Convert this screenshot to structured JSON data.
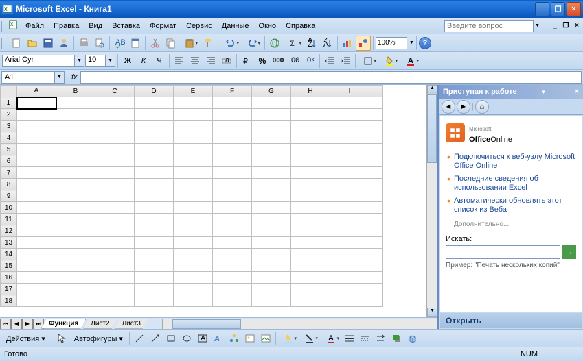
{
  "title": "Microsoft Excel - Книга1",
  "menu": {
    "file": "Файл",
    "edit": "Правка",
    "view": "Вид",
    "insert": "Вставка",
    "format": "Формат",
    "tools": "Сервис",
    "data": "Данные",
    "window": "Окно",
    "help": "Справка"
  },
  "help_placeholder": "Введите вопрос",
  "zoom": "100%",
  "font": {
    "name": "Arial Cyr",
    "size": "10"
  },
  "namebox": "A1",
  "columns": [
    "A",
    "B",
    "C",
    "D",
    "E",
    "F",
    "G",
    "H",
    "I"
  ],
  "rows": [
    "1",
    "2",
    "3",
    "4",
    "5",
    "6",
    "7",
    "8",
    "9",
    "10",
    "11",
    "12",
    "13",
    "14",
    "15",
    "16",
    "17",
    "18"
  ],
  "sheets": {
    "tab1": "Функция",
    "tab2": "Лист2",
    "tab3": "Лист3"
  },
  "drawing": {
    "actions": "Действия",
    "autoshapes": "Автофигуры"
  },
  "status": {
    "ready": "Готово",
    "num": "NUM"
  },
  "taskpane": {
    "title": "Приступая к работе",
    "office_brand": "Office",
    "office_suffix": "Online",
    "office_prefix": "Microsoft",
    "link1": "Подключиться к веб-узлу Microsoft Office Online",
    "link2": "Последние сведения об использовании Excel",
    "link3": "Автоматически обновлять этот список из Веба",
    "more": "Дополнительно...",
    "search_label": "Искать:",
    "example": "Пример: \"Печать нескольких копий\"",
    "open": "Открыть"
  }
}
